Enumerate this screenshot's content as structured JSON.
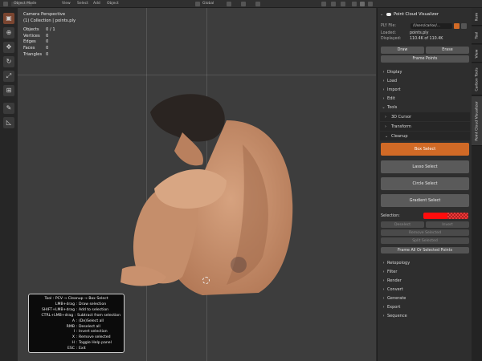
{
  "header": {
    "mode": "Object Mode",
    "menus": [
      "View",
      "Select",
      "Add",
      "Object"
    ],
    "orientation": "Global"
  },
  "toolbar": {
    "tools": [
      "select-box-icon",
      "cursor-icon",
      "move-icon",
      "rotate-icon",
      "scale-icon",
      "transform-icon",
      "annotate-icon",
      "measure-icon"
    ]
  },
  "viewport": {
    "perspective": "Camera Perspective",
    "collection": "(1) Collection | points.ply",
    "stats": [
      {
        "label": "Objects",
        "value": "0 / 1"
      },
      {
        "label": "Vertices",
        "value": "0"
      },
      {
        "label": "Edges",
        "value": "0"
      },
      {
        "label": "Faces",
        "value": "0"
      },
      {
        "label": "Triangles",
        "value": "0"
      }
    ]
  },
  "help": {
    "title": "Tool : PCV → Cleanup → Box Select",
    "lines": [
      {
        "key": "LMB+drag :",
        "desc": "Draw selection"
      },
      {
        "key": "SHIFT+LMB+drag :",
        "desc": "Add to selection"
      },
      {
        "key": "CTRL+LMB+drag :",
        "desc": "Subtract from selection"
      },
      {
        "key": "A :",
        "desc": "(De)Select all"
      },
      {
        "key": "RMB :",
        "desc": "Deselect all"
      },
      {
        "key": "I :",
        "desc": "Invert selection"
      },
      {
        "key": "X :",
        "desc": "Remove selected"
      },
      {
        "key": "H :",
        "desc": "Toggle Help panel"
      },
      {
        "key": "ESC :",
        "desc": "Exit"
      }
    ]
  },
  "panel": {
    "title": "Point Cloud Visualizer",
    "ply_file_label": "PLY File:",
    "ply_file_value": "/Users/carlos/...",
    "loaded_label": "Loaded:",
    "loaded_value": "points.ply",
    "displayed_label": "Displayed:",
    "displayed_value": "110.4K of 110.4K",
    "draw_label": "Draw",
    "erase_label": "Erase",
    "frame_points_label": "Frame Points",
    "sections": [
      "Display",
      "Load",
      "Import",
      "Edit",
      "Tools"
    ],
    "tools_sub": [
      "3D Cursor",
      "Transform",
      "Cleanup"
    ],
    "cleanup_buttons": [
      "Box Select",
      "Lasso Select",
      "Circle Select",
      "Gradient Select"
    ],
    "selection_label": "Selection:",
    "deselect_label": "Deselect",
    "invert_label": "Invert",
    "remove_selected_label": "Remove Selected",
    "split_selected_label": "Split Selected",
    "frame_all_label": "Frame All Or Selected Points",
    "more_sections": [
      "Retopology",
      "Filter",
      "Render",
      "Convert",
      "Generate",
      "Export",
      "Sequence"
    ],
    "accent_color": "#d16a26",
    "selection_color": "#ff0d0d"
  },
  "tabs": [
    "Item",
    "Tool",
    "View",
    "Carbon Tools",
    "Point Cloud Visualizer"
  ]
}
